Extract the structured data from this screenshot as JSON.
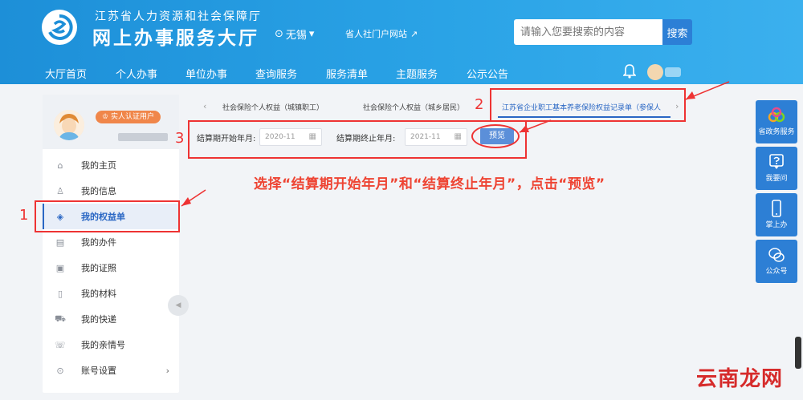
{
  "header": {
    "org_name": "江苏省人力资源和社会保障厅",
    "hall_name": "网上办事服务大厅",
    "location": "无锡",
    "portal_link": "省人社门户网站",
    "search_placeholder": "请输入您要搜索的内容",
    "search_button": "搜索"
  },
  "nav": {
    "items": [
      "大厅首页",
      "个人办事",
      "单位办事",
      "查询服务",
      "服务清单",
      "主题服务",
      "公示公告"
    ]
  },
  "sidebar": {
    "verify_badge": "实人认证用户",
    "items": [
      {
        "label": "我的主页",
        "icon": "home-icon"
      },
      {
        "label": "我的信息",
        "icon": "user-icon"
      },
      {
        "label": "我的权益单",
        "icon": "shield-icon"
      },
      {
        "label": "我的办件",
        "icon": "file-icon"
      },
      {
        "label": "我的证照",
        "icon": "id-card-icon"
      },
      {
        "label": "我的材料",
        "icon": "folder-icon"
      },
      {
        "label": "我的快递",
        "icon": "truck-icon"
      },
      {
        "label": "我的亲情号",
        "icon": "contact-icon"
      },
      {
        "label": "账号设置",
        "icon": "settings-icon"
      }
    ],
    "active_index": 2
  },
  "tabs": {
    "items": [
      "社会保险个人权益（城镇职工）",
      "社会保险个人权益（城乡居民）",
      "江苏省企业职工基本养老保险权益记录单（参保人"
    ],
    "active_index": 2,
    "prev_arrow": "‹",
    "next_arrow": "›"
  },
  "filter": {
    "start_label": "结算期开始年月:",
    "start_value": "2020-11",
    "end_label": "结算期终止年月:",
    "end_value": "2021-11",
    "preview_button": "预览"
  },
  "annotations": {
    "num1": "1",
    "num2": "2",
    "num3": "3",
    "instruction": "选择“结算期开始年月”和“结算终止年月”，点击“预览”"
  },
  "side_tools": [
    {
      "label": "省政务服务",
      "icon": "service-icon"
    },
    {
      "label": "我要问",
      "icon": "question-icon"
    },
    {
      "label": "掌上办",
      "icon": "phone-icon"
    },
    {
      "label": "公众号",
      "icon": "wechat-icon"
    }
  ],
  "watermark": "云南龙网",
  "colors": {
    "header_blue": "#2aa3e6",
    "accent": "#2a67c4",
    "annotation_red": "#e33"
  }
}
